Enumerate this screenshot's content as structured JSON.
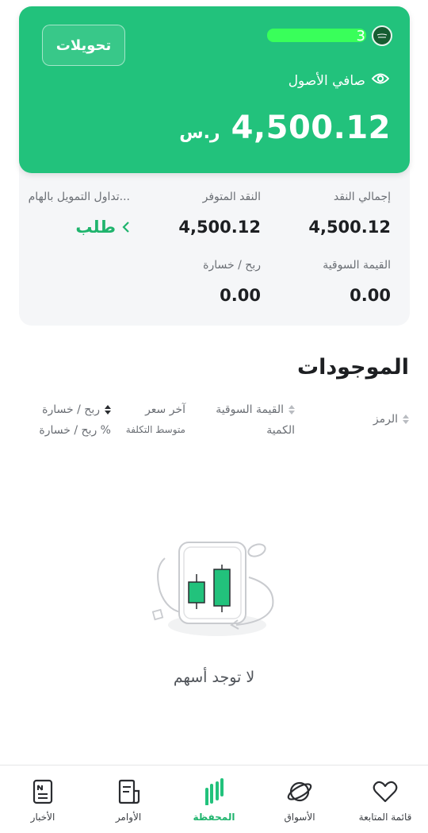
{
  "header": {
    "transfers_label": "تحويلات",
    "account_suffix": "3",
    "net_assets_label": "صافي الأصول",
    "net_assets_value": "4,500.12",
    "currency": "ر.س"
  },
  "summary": {
    "total_cash": {
      "label": "إجمالي النقد",
      "value": "4,500.12"
    },
    "available_cash": {
      "label": "النقد المتوفر",
      "value": "4,500.12"
    },
    "margin_trading": {
      "label": "تداول التمويل بالهام...",
      "value": "طلب"
    },
    "market_value": {
      "label": "القيمة السوقية",
      "value": "0.00"
    },
    "profit_loss": {
      "label": "ربح / خسارة",
      "value": "0.00"
    }
  },
  "holdings": {
    "title": "الموجودات",
    "columns": {
      "symbol": "الرمز",
      "market_value": "القيمة السوقية",
      "quantity": "الكمية",
      "last_price": "آخر سعر",
      "avg_cost": "متوسط التكلفة",
      "profit_loss": "ربح / خسارة",
      "profit_loss_pct": "ربح / خسارة %"
    },
    "empty_text": "لا توجد أسهم"
  },
  "nav": {
    "items": [
      {
        "label": "قائمة المتابعة",
        "icon": "heart-icon",
        "active": false
      },
      {
        "label": "الأسواق",
        "icon": "planet-icon",
        "active": false
      },
      {
        "label": "المحفظة",
        "icon": "portfolio-bars-icon",
        "active": true
      },
      {
        "label": "الأوامر",
        "icon": "orders-document-icon",
        "active": false
      },
      {
        "label": "الأخبار",
        "icon": "news-icon",
        "active": false
      }
    ]
  },
  "colors": {
    "brand_green": "#22c27c",
    "link_green": "#1fb46d",
    "account_mask": "#39ff5a"
  }
}
